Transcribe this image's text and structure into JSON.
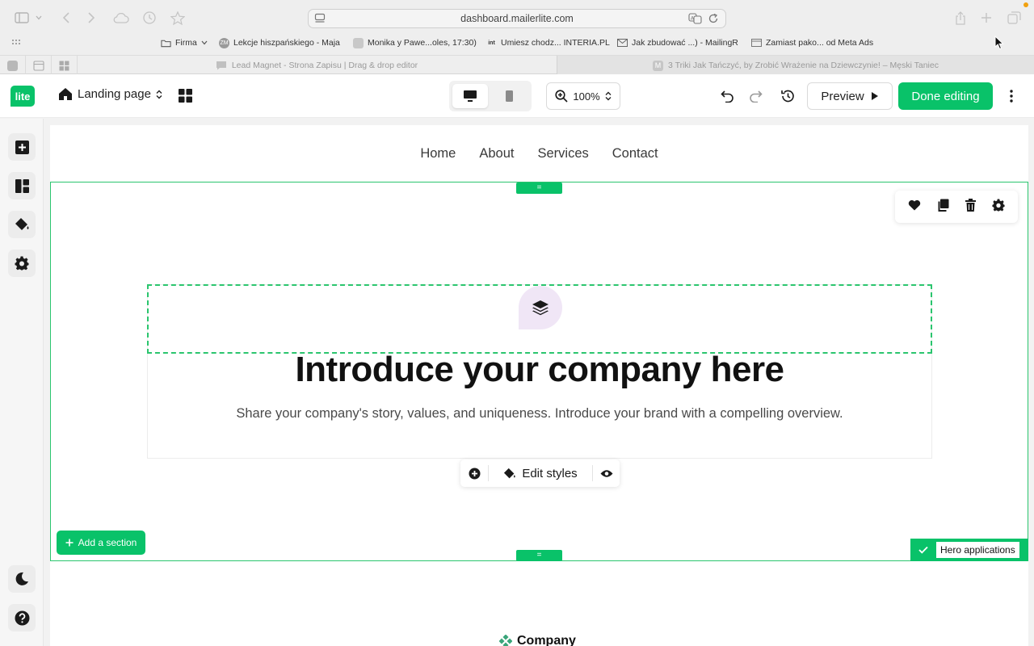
{
  "browser": {
    "url": "dashboard.mailerlite.com",
    "bookmarks": [
      {
        "label": "Firma",
        "icon": "folder-icon"
      },
      {
        "label": "Lekcje hiszpańskiego - Maja",
        "icon": "zm-icon",
        "icon_text": "ZM"
      },
      {
        "label": "Monika y Pawe...oles, 17:30)",
        "icon": "page-icon"
      },
      {
        "label": "Umiesz chodz... INTERIA.PL",
        "icon": "int-icon",
        "icon_text": "int"
      },
      {
        "label": "Jak zbudować ...) - MailingR",
        "icon": "mail-icon"
      },
      {
        "label": "Zamiast pako... od Meta Ads",
        "icon": "page-icon"
      }
    ],
    "tabs": [
      {
        "label": "Lead Magnet - Strona Zapisu | Drag & drop editor",
        "active": true
      },
      {
        "label": "3 Triki Jak Tańczyć, by Zrobić Wrażenie na Dziewczynie! – Męski Taniec",
        "active": false,
        "favicon_text": "M"
      }
    ]
  },
  "app": {
    "logo_text": "lite",
    "page_selector": "Landing page",
    "zoom": "100%",
    "preview_label": "Preview",
    "done_label": "Done editing",
    "accent_color": "#09c269"
  },
  "canvas": {
    "nav": [
      "Home",
      "About",
      "Services",
      "Contact"
    ],
    "section_handle": "=",
    "headline": "Introduce your company here",
    "subline": "Share your company's story, values, and uniqueness. Introduce your brand with a compelling overview.",
    "block_toolbar": {
      "edit_label": "Edit styles"
    },
    "add_section_label": "Add a section",
    "section_tag": "Hero applications",
    "next_section_title": "Company"
  }
}
